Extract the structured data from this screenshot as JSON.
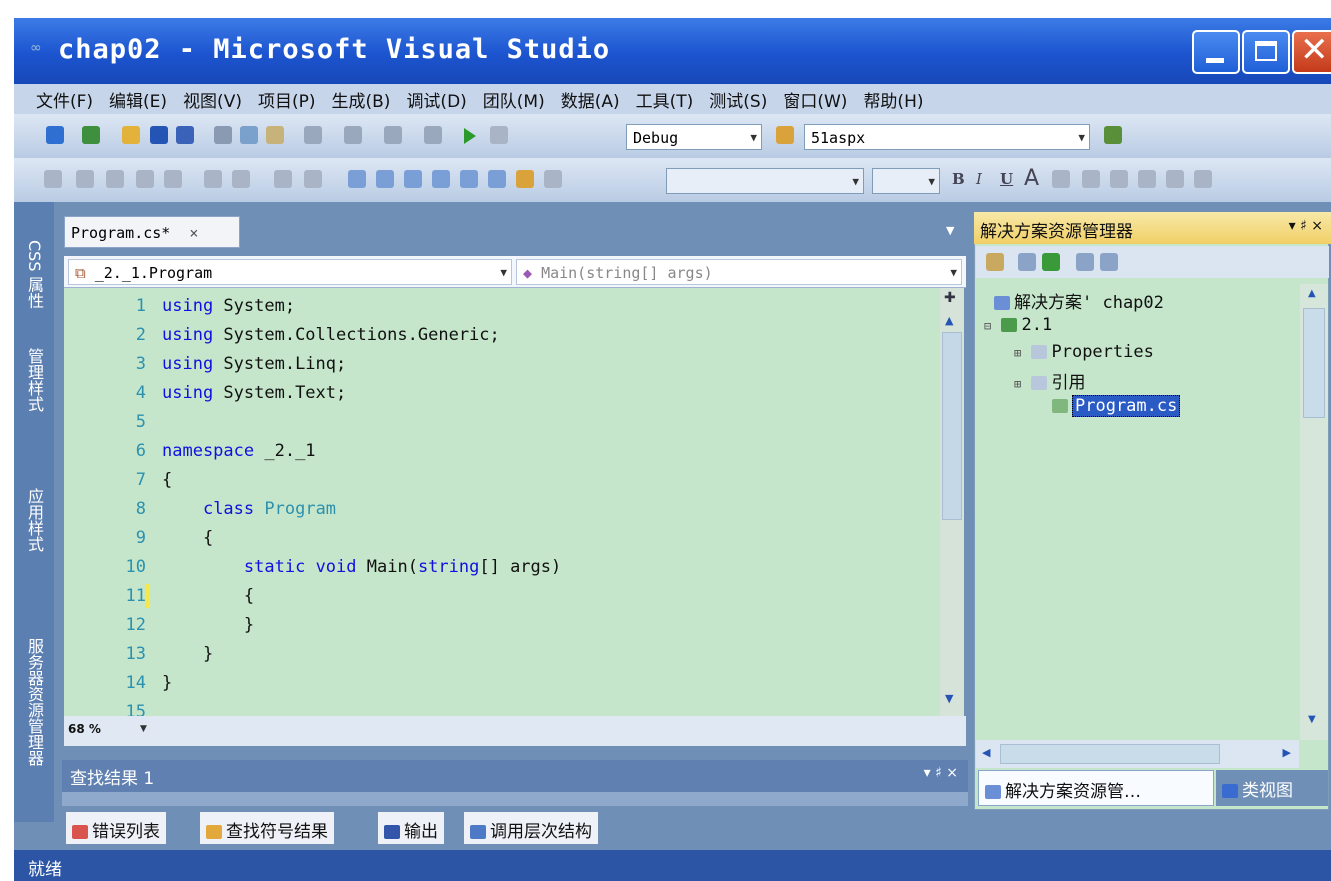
{
  "window": {
    "title": "chap02 - Microsoft Visual Studio",
    "minimize_icon": "minimize-icon",
    "maximize_icon": "maximize-icon",
    "close_icon": "close-icon"
  },
  "menubar": {
    "items": [
      "文件(F)",
      "编辑(E)",
      "视图(V)",
      "项目(P)",
      "生成(B)",
      "调试(D)",
      "团队(M)",
      "数据(A)",
      "工具(T)",
      "测试(S)",
      "窗口(W)",
      "帮助(H)"
    ]
  },
  "toolbar": {
    "configuration": "Debug",
    "project_combo": "51aspx",
    "format_bold": "B",
    "format_italic": "I",
    "format_underline": "U",
    "format_font": "A"
  },
  "left_strip": {
    "tabs": [
      "CSS 属性",
      "管理样式",
      "应用样式",
      "服务器资源管理器"
    ]
  },
  "editor": {
    "tab_label": "Program.cs*",
    "tab_close": "×",
    "nav_class": "_2._1.Program",
    "nav_member": "Main(string[] args)",
    "zoom": "68 %",
    "lines": [
      {
        "n": "1",
        "text": "using System;"
      },
      {
        "n": "2",
        "text": "using System.Collections.Generic;"
      },
      {
        "n": "3",
        "text": "using System.Linq;"
      },
      {
        "n": "4",
        "text": "using System.Text;"
      },
      {
        "n": "5",
        "text": ""
      },
      {
        "n": "6",
        "text": "namespace _2._1"
      },
      {
        "n": "7",
        "text": "{"
      },
      {
        "n": "8",
        "text": "    class Program"
      },
      {
        "n": "9",
        "text": "    {"
      },
      {
        "n": "10",
        "text": "        static void Main(string[] args)"
      },
      {
        "n": "11",
        "text": "        {"
      },
      {
        "n": "12",
        "text": "        }"
      },
      {
        "n": "13",
        "text": "    }"
      },
      {
        "n": "14",
        "text": "}"
      },
      {
        "n": "15",
        "text": ""
      }
    ]
  },
  "find_results": {
    "title": "查找结果 1",
    "pin": "▾ ♯ ×"
  },
  "bottom_tabs": [
    "错误列表",
    "查找符号结果",
    "输出",
    "调用层次结构"
  ],
  "statusbar": {
    "text": "就绪"
  },
  "solution_explorer": {
    "title": "解决方案资源管理器",
    "title_buttons": "▾ ♯ ×",
    "solution": "解决方案' chap02",
    "project": "2.1",
    "properties": "Properties",
    "references": "引用",
    "file": "Program.cs",
    "tabs": [
      "解决方案资源管…",
      "类视图"
    ]
  }
}
